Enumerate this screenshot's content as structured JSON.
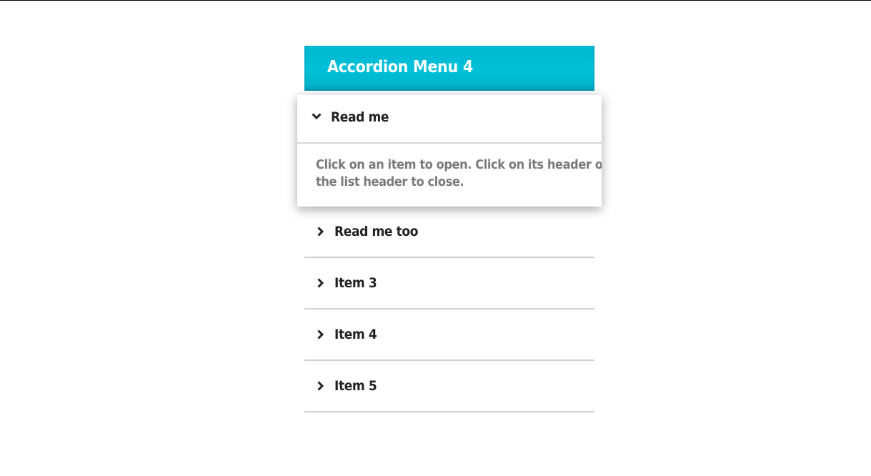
{
  "accordion": {
    "title": "Accordion Menu 4",
    "accent_color": "#00bcd4",
    "open_item": {
      "label": "Read me",
      "icon": "chevron-down-icon",
      "body_line1": "Click on an item to open. Click on its header or",
      "body_line2": "the list header to close."
    },
    "items": [
      {
        "label": "Read me too",
        "icon": "chevron-right-icon"
      },
      {
        "label": "Item 3",
        "icon": "chevron-right-icon"
      },
      {
        "label": "Item 4",
        "icon": "chevron-right-icon"
      },
      {
        "label": "Item 5",
        "icon": "chevron-right-icon"
      }
    ]
  }
}
